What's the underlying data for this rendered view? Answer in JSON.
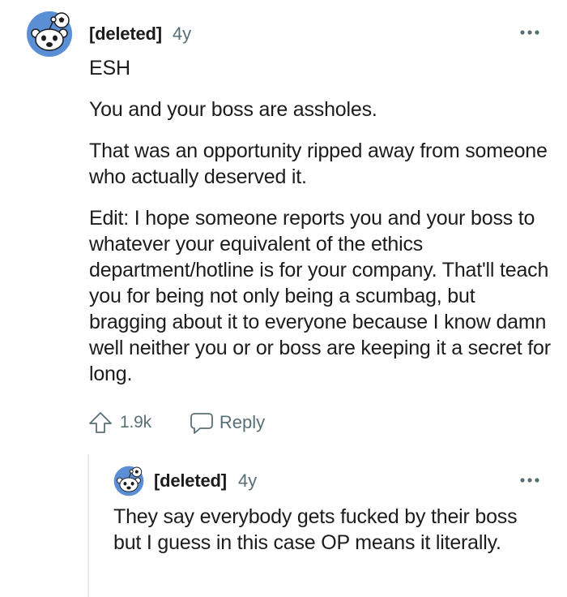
{
  "comment": {
    "author": "[deleted]",
    "age": "4y",
    "paragraphs": [
      "ESH",
      "You and your boss are assholes.",
      "That was an opportunity ripped away from someone who actually deserved it.",
      "Edit: I hope someone reports you and your boss to whatever your equivalent of the ethics department/hotline is for your company. That'll teach you for being not only being a scumbag, but bragging about it to everyone because I know damn well neither you or or boss are keeping it a secret for long."
    ],
    "upvotes": "1.9k",
    "reply_label": "Reply",
    "avatar_icon": "reddit-snoo-avatar",
    "more_icon": "more-options-icon"
  },
  "reply": {
    "author": "[deleted]",
    "age": "4y",
    "text": "They say everybody gets fucked by their boss but I guess in this case OP means it literally.",
    "avatar_icon": "reddit-snoo-avatar"
  },
  "colors": {
    "text": "#1c1c1c",
    "meta": "#576f76",
    "avatar_bg": "#5a8fd6",
    "thread_line": "#e5ebee"
  }
}
